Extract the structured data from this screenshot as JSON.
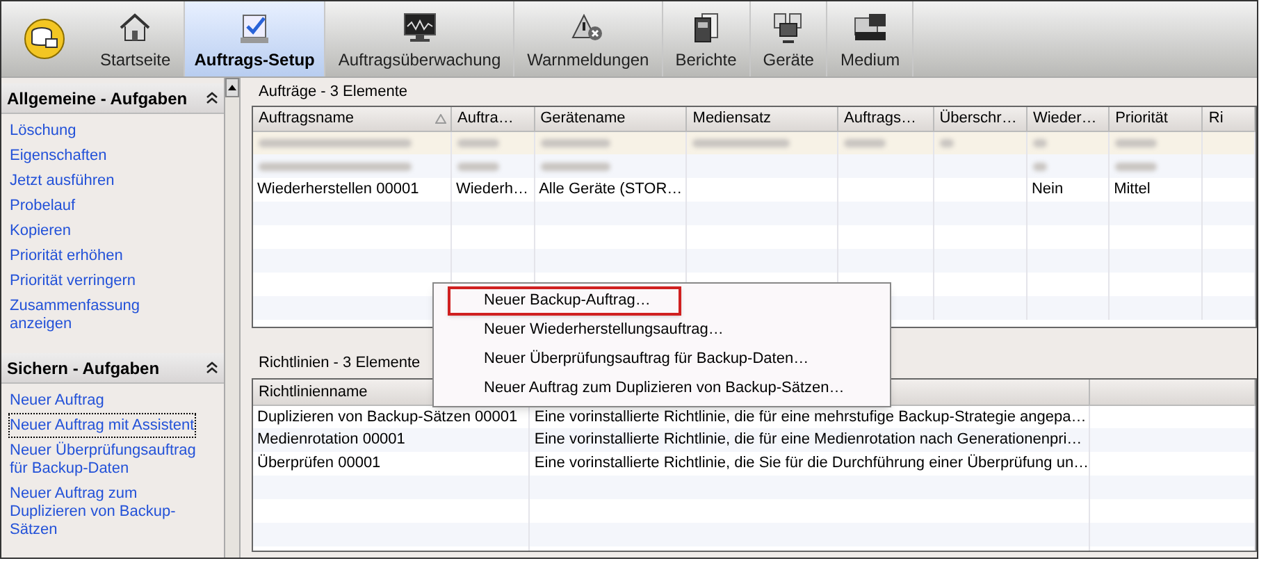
{
  "toolbar": {
    "tabs": [
      {
        "label": "Startseite",
        "selected": false
      },
      {
        "label": "Auftrags-Setup",
        "selected": true
      },
      {
        "label": "Auftragsüberwachung",
        "selected": false
      },
      {
        "label": "Warnmeldungen",
        "selected": false
      },
      {
        "label": "Berichte",
        "selected": false
      },
      {
        "label": "Geräte",
        "selected": false
      },
      {
        "label": "Medium",
        "selected": false
      }
    ]
  },
  "sidebar": {
    "sections": [
      {
        "title": "Allgemeine - Aufgaben",
        "items": [
          {
            "label": "Löschung",
            "focused": false
          },
          {
            "label": "Eigenschaften",
            "focused": false
          },
          {
            "label": "Jetzt ausführen",
            "focused": false
          },
          {
            "label": "Probelauf",
            "focused": false
          },
          {
            "label": "Kopieren",
            "focused": false
          },
          {
            "label": "Priorität erhöhen",
            "focused": false
          },
          {
            "label": "Priorität verringern",
            "focused": false
          },
          {
            "label": "Zusammenfassung anzeigen",
            "focused": false
          }
        ]
      },
      {
        "title": "Sichern - Aufgaben",
        "items": [
          {
            "label": "Neuer Auftrag",
            "focused": false
          },
          {
            "label": "Neuer Auftrag mit Assistent",
            "focused": true
          },
          {
            "label": "Neuer Überprüfungsauftrag für Backup-Daten",
            "focused": false
          },
          {
            "label": "Neuer Auftrag zum Duplizieren von Backup-Sätzen",
            "focused": false
          }
        ]
      }
    ]
  },
  "jobs": {
    "title": "Aufträge - 3 Elemente",
    "columns": [
      "Auftragsname",
      "Auftra…",
      "Gerätename",
      "Mediensatz",
      "Auftrags…",
      "Überschr…",
      "Wieder…",
      "Priorität",
      "Ri"
    ],
    "rows": [
      {
        "kind": "blurred",
        "cells": []
      },
      {
        "kind": "blurred",
        "cells": []
      },
      {
        "kind": "text",
        "cells": [
          "Wiederherstellen 00001",
          "Wiederh…",
          "Alle Geräte (STOR…",
          "",
          "",
          "",
          "Nein",
          "Mittel",
          ""
        ]
      }
    ]
  },
  "policies": {
    "title": "Richtlinien - 3 Elemente",
    "columns": [
      "Richtlinienname"
    ],
    "rows": [
      [
        "Duplizieren von Backup-Sätzen 00001",
        "Eine vorinstallierte Richtlinie, die für eine mehrstufige Backup-Strategie angepa…"
      ],
      [
        "Medienrotation 00001",
        "Eine vorinstallierte Richtlinie, die für eine Medienrotation nach Generationenpri…"
      ],
      [
        "Überprüfen 00001",
        "Eine vorinstallierte Richtlinie, die Sie für die Durchführung einer Überprüfung un…"
      ]
    ]
  },
  "context_menu": {
    "items": [
      {
        "label": "Neuer Backup-Auftrag…",
        "highlighted": true
      },
      {
        "label": "Neuer Wiederherstellungsauftrag…",
        "highlighted": false
      },
      {
        "label": "Neuer Überprüfungsauftrag für Backup-Daten…",
        "highlighted": false
      },
      {
        "label": "Neuer Auftrag zum Duplizieren von Backup-Sätzen…",
        "highlighted": false
      }
    ]
  }
}
